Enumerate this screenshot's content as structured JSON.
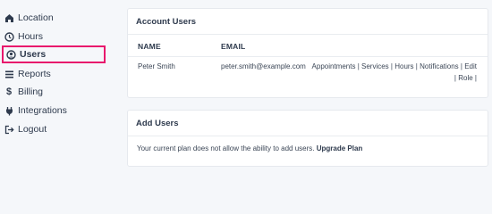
{
  "sidebar": {
    "items": [
      {
        "label": "Location",
        "icon": "building-icon"
      },
      {
        "label": "Hours",
        "icon": "clock-icon"
      },
      {
        "label": "Users",
        "icon": "user-circle-icon",
        "active": true
      },
      {
        "label": "Reports",
        "icon": "list-icon"
      },
      {
        "label": "Billing",
        "icon": "dollar-icon"
      },
      {
        "label": "Integrations",
        "icon": "plug-icon"
      },
      {
        "label": "Logout",
        "icon": "logout-icon"
      }
    ],
    "active_color": "#e8176c"
  },
  "account_users": {
    "title": "Account Users",
    "columns": [
      "NAME",
      "EMAIL"
    ],
    "rows": [
      {
        "name": "Peter Smith",
        "email": "peter.smith@example.com",
        "actions": [
          "Appointments",
          "Services",
          "Hours",
          "Notifications",
          "Edit",
          "Role"
        ]
      }
    ]
  },
  "add_users": {
    "title": "Add Users",
    "message": "Your current plan does not allow the ability to add users.",
    "upgrade_label": "Upgrade Plan"
  }
}
